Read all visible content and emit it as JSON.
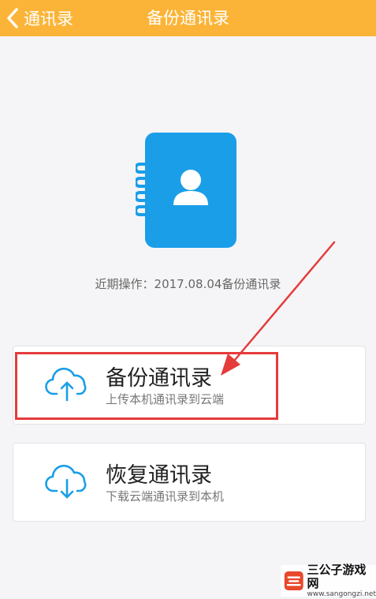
{
  "header": {
    "back_label": "通讯录",
    "title": "备份通讯录",
    "bg_color": "#fbb437"
  },
  "icons": {
    "contacts_book": "contacts-book-icon",
    "upload": "cloud-upload-icon",
    "download": "cloud-download-icon"
  },
  "accent_color": "#1a9ee8",
  "recent_operation": "近期操作：2017.08.04备份通讯录",
  "actions": [
    {
      "label": "备份通讯录",
      "sub": "上传本机通讯录到云端",
      "icon": "cloud-upload-icon"
    },
    {
      "label": "恢复通讯录",
      "sub": "下载云端通讯录到本机",
      "icon": "cloud-download-icon"
    }
  ],
  "annotation_color": "#e53b3b",
  "watermark": {
    "name": "三公子游戏网",
    "url": "www.sangongzi.net"
  }
}
